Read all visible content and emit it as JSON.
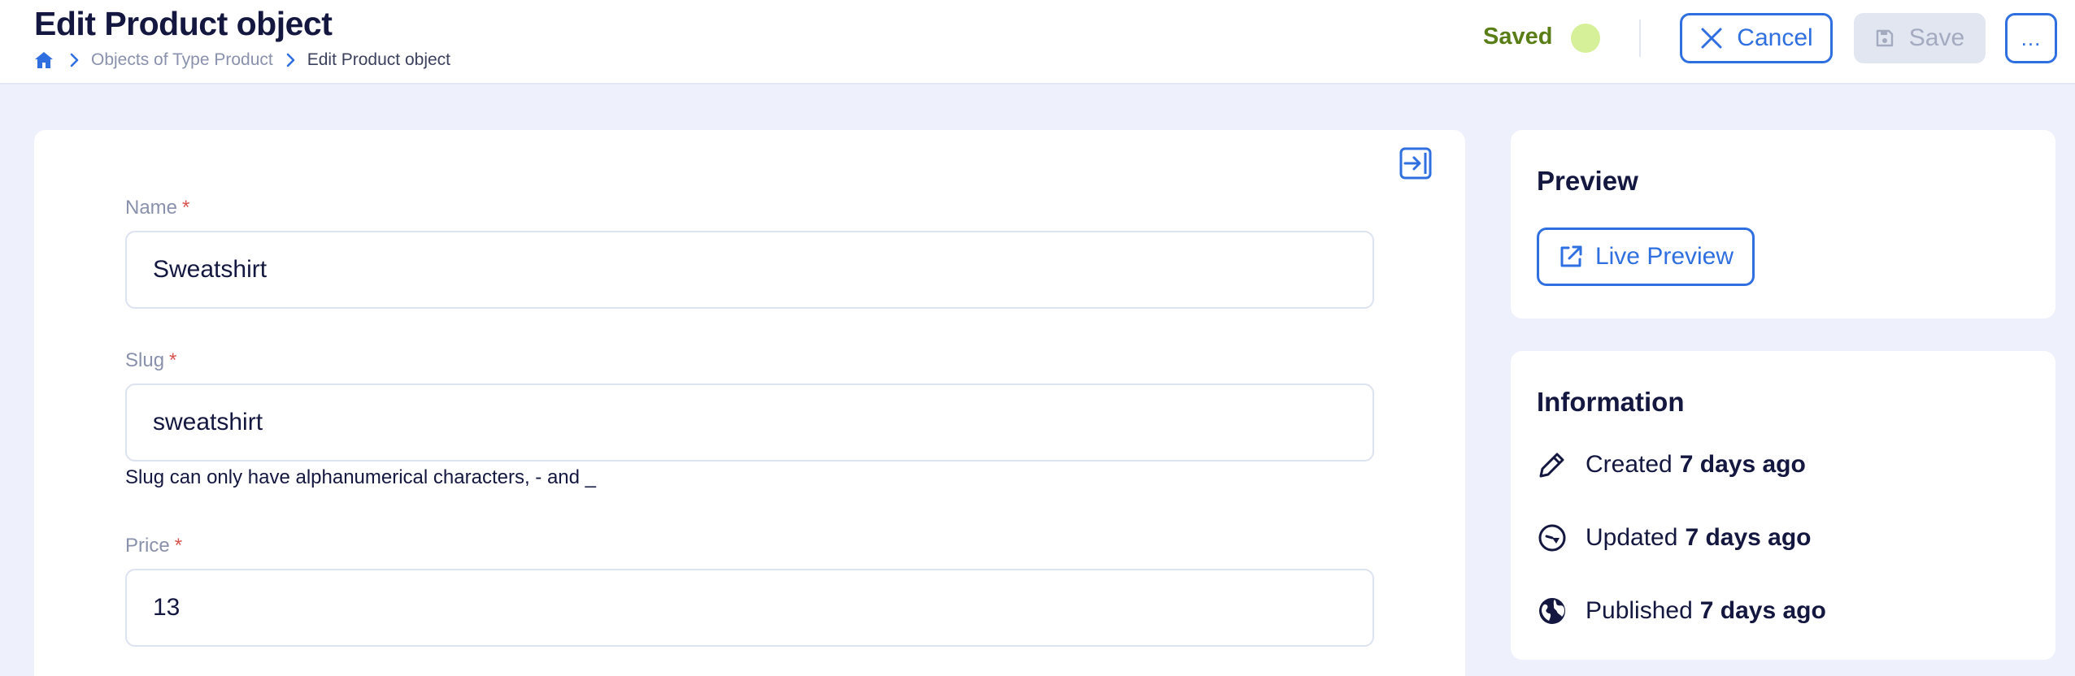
{
  "header": {
    "title": "Edit Product object",
    "breadcrumb": [
      "Objects of Type Product",
      "Edit Product object"
    ],
    "status": "Saved",
    "cancel_label": "Cancel",
    "save_label": "Save",
    "more_label": "..."
  },
  "form": {
    "fields": [
      {
        "label": "Name",
        "required": "*",
        "value": "Sweatshirt"
      },
      {
        "label": "Slug",
        "required": "*",
        "value": "sweatshirt",
        "helper": "Slug can only have alphanumerical characters, - and _"
      },
      {
        "label": "Price",
        "required": "*",
        "value": "13"
      }
    ]
  },
  "preview": {
    "title": "Preview",
    "button_label": "Live Preview"
  },
  "information": {
    "title": "Information",
    "rows": [
      {
        "label": "Created",
        "value": "7 days ago",
        "icon": "pencil-icon"
      },
      {
        "label": "Updated",
        "value": "7 days ago",
        "icon": "clock-icon"
      },
      {
        "label": "Published",
        "value": "7 days ago",
        "icon": "globe-icon"
      }
    ]
  },
  "colors": {
    "accent": "#2f6fe0",
    "saved_text": "#5a7e17",
    "saved_dot": "#d6f09a",
    "required": "#d9534f"
  }
}
